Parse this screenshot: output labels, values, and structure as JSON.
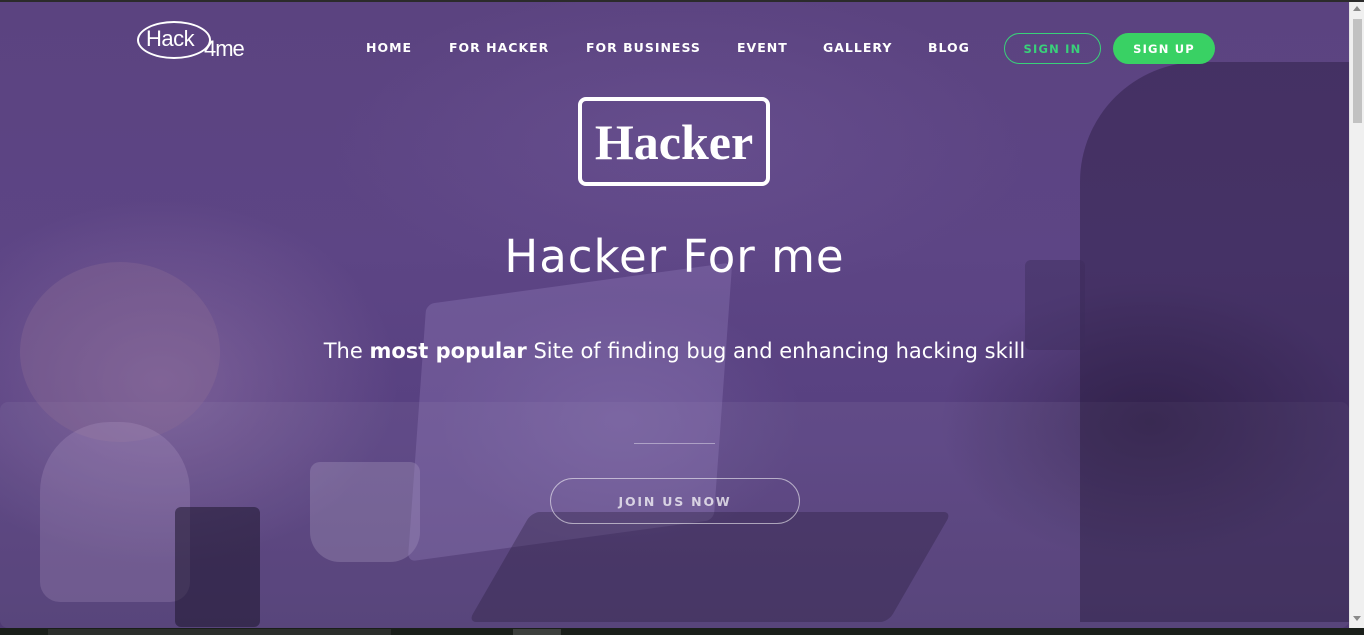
{
  "logo": {
    "main": "Hack",
    "suffix": "4me"
  },
  "nav": {
    "links": [
      "HOME",
      "FOR HACKER",
      "FOR BUSINESS",
      "EVENT",
      "GALLERY",
      "BLOG"
    ],
    "sign_in": "SIGN IN",
    "sign_up": "SIGN UP"
  },
  "hero": {
    "badge": "Hacker",
    "headline": "Hacker For me",
    "subtitle_pre": "The ",
    "subtitle_bold": "most popular",
    "subtitle_post": " Site of finding bug and enhancing hacking skill",
    "cta": "JOIN US NOW"
  },
  "colors": {
    "overlay": "#5b4380",
    "accent_green": "#39d164",
    "text": "#ffffff"
  }
}
